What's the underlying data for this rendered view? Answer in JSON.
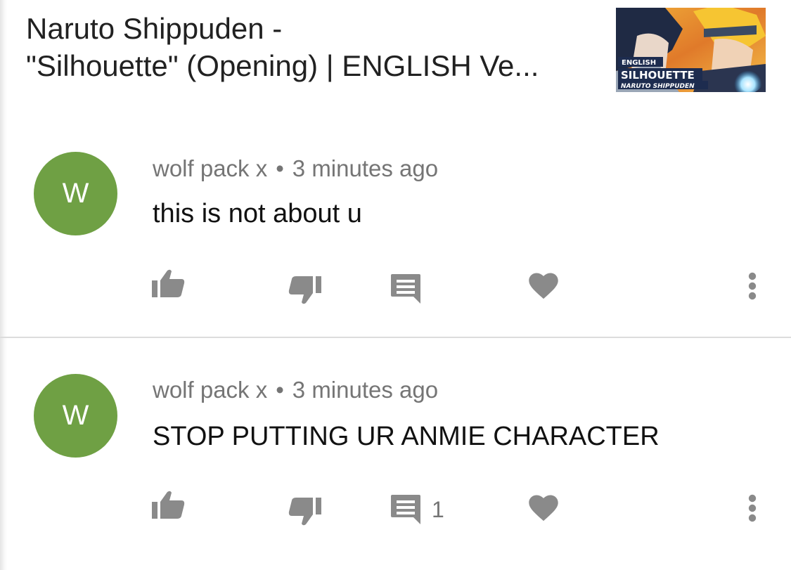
{
  "video": {
    "title_line1": "Naruto Shippuden -",
    "title_line2": "\"Silhouette\" (Opening) | ENGLISH Ve...",
    "thumbnail": {
      "text_english": "ENGLISH",
      "text_title": "SILHOUETTE",
      "text_series": "NARUTO SHIPPUDEN"
    }
  },
  "comments": [
    {
      "avatar_letter": "W",
      "avatar_color": "#6fa044",
      "author": "wolf pack x",
      "separator": "•",
      "time": "3 minutes ago",
      "text": "this is not about u",
      "reply_count": ""
    },
    {
      "avatar_letter": "W",
      "avatar_color": "#6fa044",
      "author": "wolf pack x",
      "separator": "•",
      "time": "3 minutes ago",
      "text": "STOP PUTTING UR ANMIE CHARACTER",
      "reply_count": "1"
    }
  ],
  "icons": {
    "like": "thumb-up-icon",
    "dislike": "thumb-down-icon",
    "reply": "comment-icon",
    "heart": "heart-icon",
    "more": "more-vert-icon"
  },
  "colors": {
    "icon_gray": "#8a8a8a",
    "text_primary": "#212121",
    "text_secondary": "#757575"
  }
}
